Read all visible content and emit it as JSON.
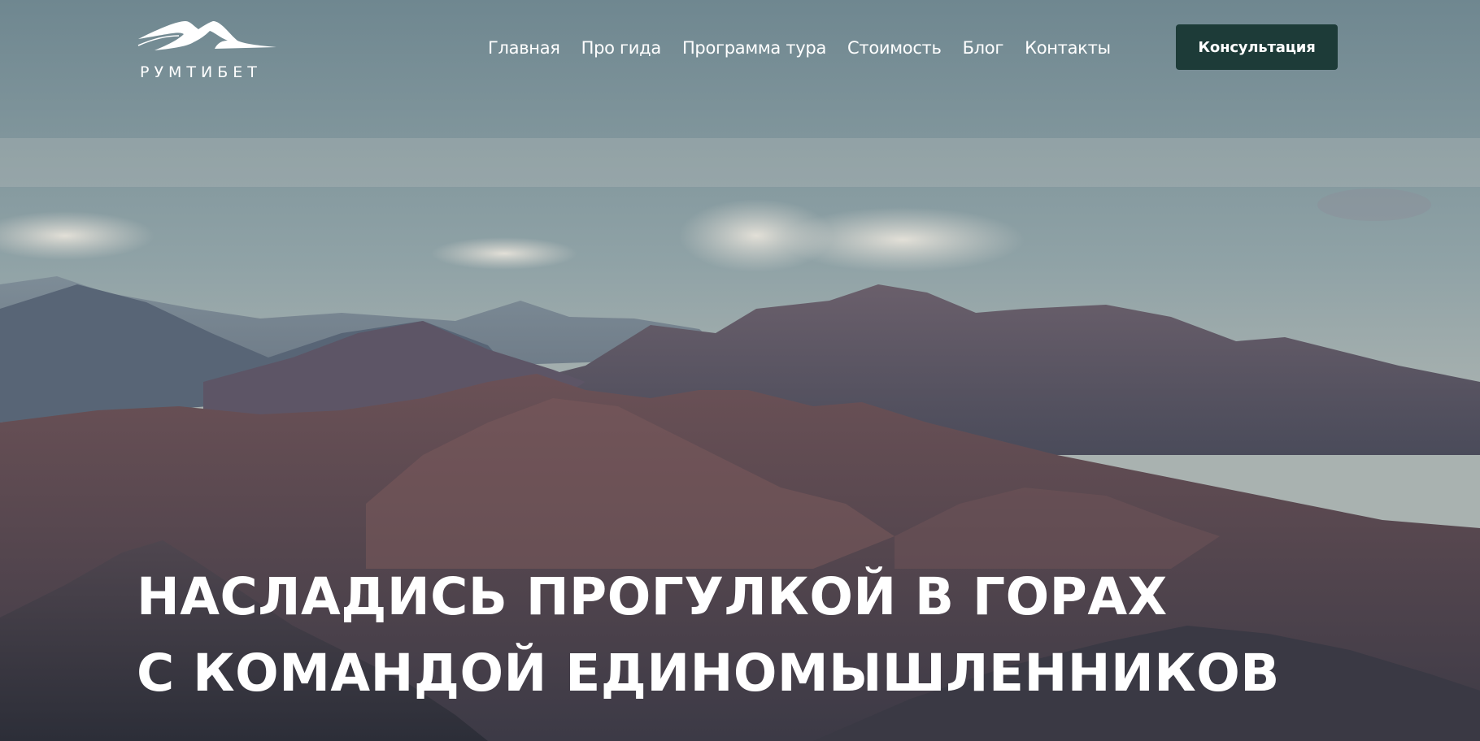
{
  "brand": {
    "name": "РУМТИБЕТ"
  },
  "nav": {
    "items": [
      {
        "label": "Главная"
      },
      {
        "label": "Про гида"
      },
      {
        "label": "Программа тура"
      },
      {
        "label": "Стоимость"
      },
      {
        "label": "Блог"
      },
      {
        "label": "Контакты"
      }
    ]
  },
  "cta": {
    "label": "Консультация"
  },
  "hero": {
    "headline_line1": "НАСЛАДИСЬ ПРОГУЛКОЙ В ГОРАХ",
    "headline_line2": "С КОМАНДОЙ ЕДИНОМЫШЛЕННИКОВ"
  },
  "colors": {
    "cta_background": "#1d3b38",
    "text": "#ffffff",
    "sky": "#7b8f97",
    "mountain_dark": "#3a3a45"
  },
  "icons": {
    "logo": "mountain-logo-icon"
  }
}
